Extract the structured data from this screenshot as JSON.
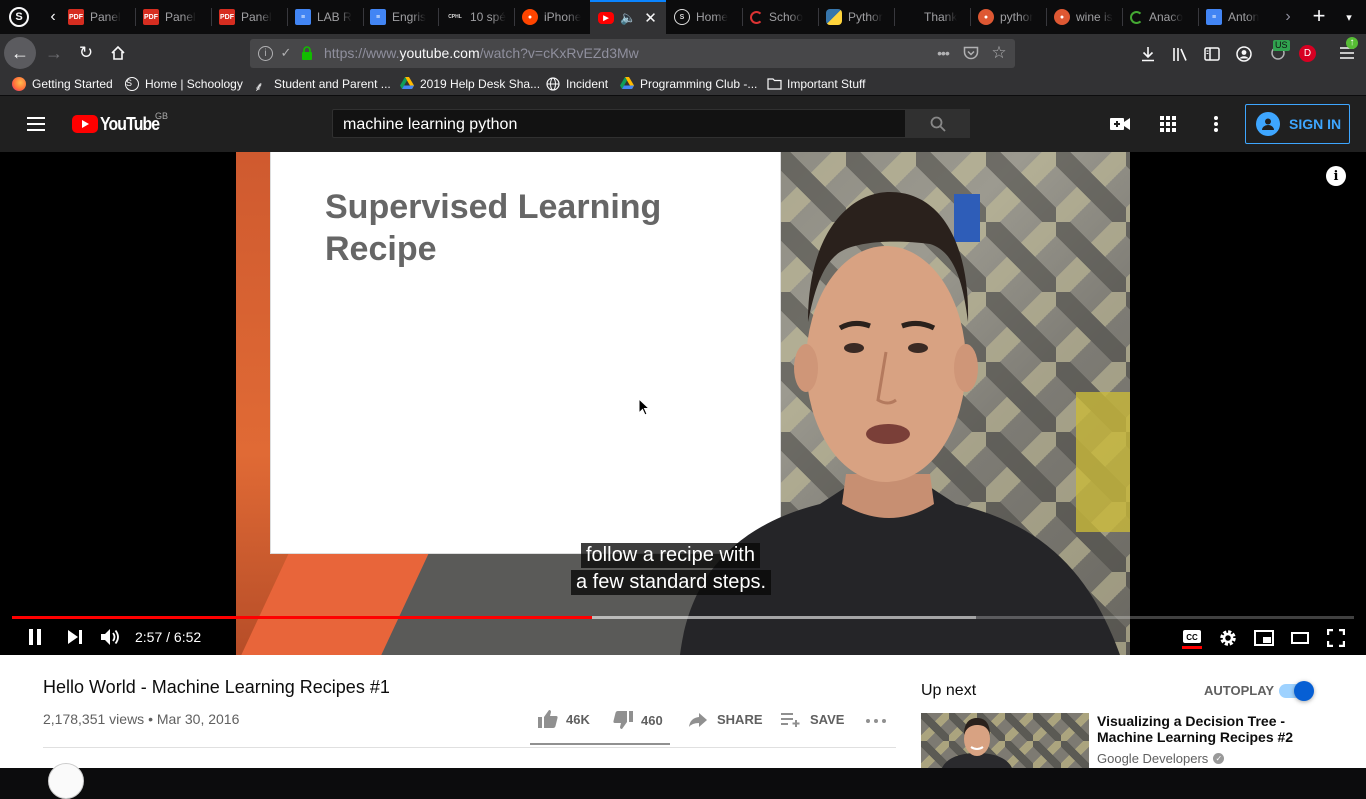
{
  "browser": {
    "tabs": [
      {
        "title": "Panel",
        "icon": "pdf-icon"
      },
      {
        "title": "Panel",
        "icon": "pdf-icon"
      },
      {
        "title": "Panel",
        "icon": "pdf-icon"
      },
      {
        "title": "LAB R",
        "icon": "docs-icon"
      },
      {
        "title": "Engris",
        "icon": "docs-icon"
      },
      {
        "title": "10 spé",
        "icon": "site-icon",
        "favicon_text": "CPHL"
      },
      {
        "title": "iPhone",
        "icon": "reddit-icon"
      },
      {
        "title": "",
        "icon": "youtube-icon",
        "active": true
      },
      {
        "title": "Home",
        "icon": "schoology-icon"
      },
      {
        "title": "Schoo",
        "icon": "loading-icon"
      },
      {
        "title": "Pythor",
        "icon": "python-icon"
      },
      {
        "title": "Thank",
        "icon": "blank-icon"
      },
      {
        "title": "pythor",
        "icon": "duckduckgo-icon"
      },
      {
        "title": "wine is",
        "icon": "duckduckgo-icon"
      },
      {
        "title": "Anaco",
        "icon": "loading-icon"
      },
      {
        "title": "Anton",
        "icon": "docs-icon"
      }
    ],
    "url_prefix": "https://www.",
    "url_domain": "youtube.com",
    "url_path": "/watch?v=cKxRvEZd3Mw",
    "ext_badge": "US",
    "profile_letter": "D",
    "bookmarks": [
      {
        "label": "Getting Started",
        "icon": "firefox-icon"
      },
      {
        "label": "Home | Schoology",
        "icon": "schoology-icon"
      },
      {
        "label": "Student and Parent ...",
        "icon": "page-icon"
      },
      {
        "label": "2019 Help Desk Sha...",
        "icon": "drive-icon"
      },
      {
        "label": "Incident",
        "icon": "globe-icon"
      },
      {
        "label": "Programming Club -...",
        "icon": "drive-icon"
      },
      {
        "label": "Important Stuff",
        "icon": "folder-icon"
      }
    ]
  },
  "youtube": {
    "logo_text": "YouTube",
    "region": "GB",
    "search_value": "machine learning python",
    "sign_in_label": "SIGN IN",
    "accent": "#ff0000",
    "signin_color": "#3ea6ff"
  },
  "video": {
    "slide_title_line1": "Supervised Learning",
    "slide_title_line2": "Recipe",
    "caption_line1": "follow a recipe with",
    "caption_line2": "a few standard steps.",
    "time_current": "2:57",
    "time_total": "6:52",
    "time_separator": " / ",
    "progress": 0.432,
    "buffered": 0.718
  },
  "info": {
    "title": "Hello World - Machine Learning Recipes #1",
    "views": "2,178,351 views",
    "separator": "•",
    "date": "Mar 30, 2016",
    "likes": "46K",
    "dislikes": "460",
    "share_label": "SHARE",
    "save_label": "SAVE"
  },
  "sidebar": {
    "up_next_label": "Up next",
    "autoplay_label": "AUTOPLAY",
    "autoplay_on": true,
    "next_title": "Visualizing a Decision Tree - Machine Learning Recipes #2",
    "next_channel": "Google Developers"
  }
}
